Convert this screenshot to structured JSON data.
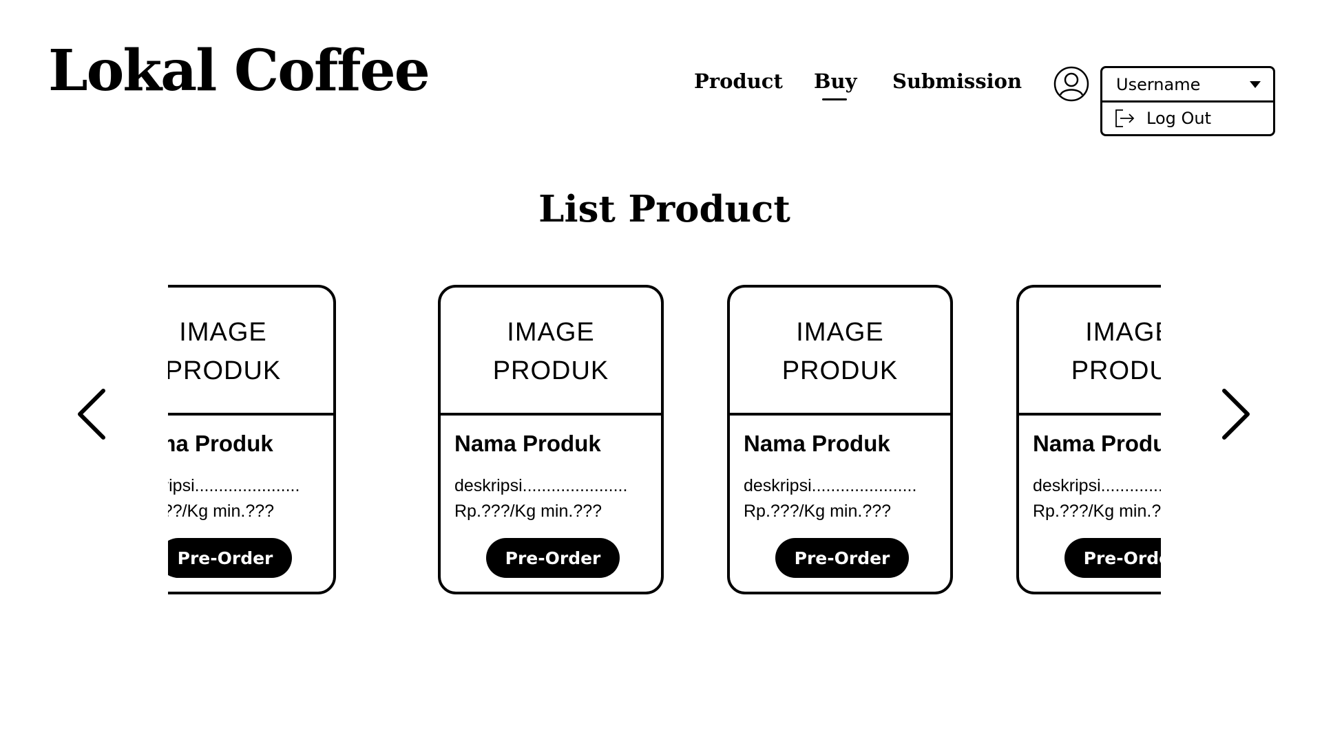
{
  "header": {
    "brand": "Lokal Coffee",
    "nav": [
      {
        "label": "Product"
      },
      {
        "label": "Buy"
      },
      {
        "label": "Submission"
      }
    ],
    "active_nav": "Buy",
    "user_menu": {
      "username": "Username",
      "items": [
        {
          "label": "Log Out",
          "icon": "logout-icon"
        }
      ]
    }
  },
  "main": {
    "title": "List Product",
    "products": [
      {
        "image_line1": "IMAGE",
        "image_line2": "PRODUK",
        "name": "Nama Produk",
        "description": "deskripsi......................",
        "price": "Rp.???/Kg min.???",
        "button": "Pre-Order"
      },
      {
        "image_line1": "IMAGE",
        "image_line2": "PRODUK",
        "name": "Nama Produk",
        "description": "deskripsi......................",
        "price": "Rp.???/Kg min.???",
        "button": "Pre-Order"
      },
      {
        "image_line1": "IMAGE",
        "image_line2": "PRODUK",
        "name": "Nama Produk",
        "description": "deskripsi......................",
        "price": "Rp.???/Kg min.???",
        "button": "Pre-Order"
      },
      {
        "image_line1": "IMAGE",
        "image_line2": "PRODUK",
        "name": "Nama Produk",
        "description": "deskripsi......................",
        "price": "Rp.???/Kg min.???",
        "button": "Pre-Order"
      }
    ],
    "prev_icon": "chevron-left-icon",
    "next_icon": "chevron-right-icon"
  }
}
